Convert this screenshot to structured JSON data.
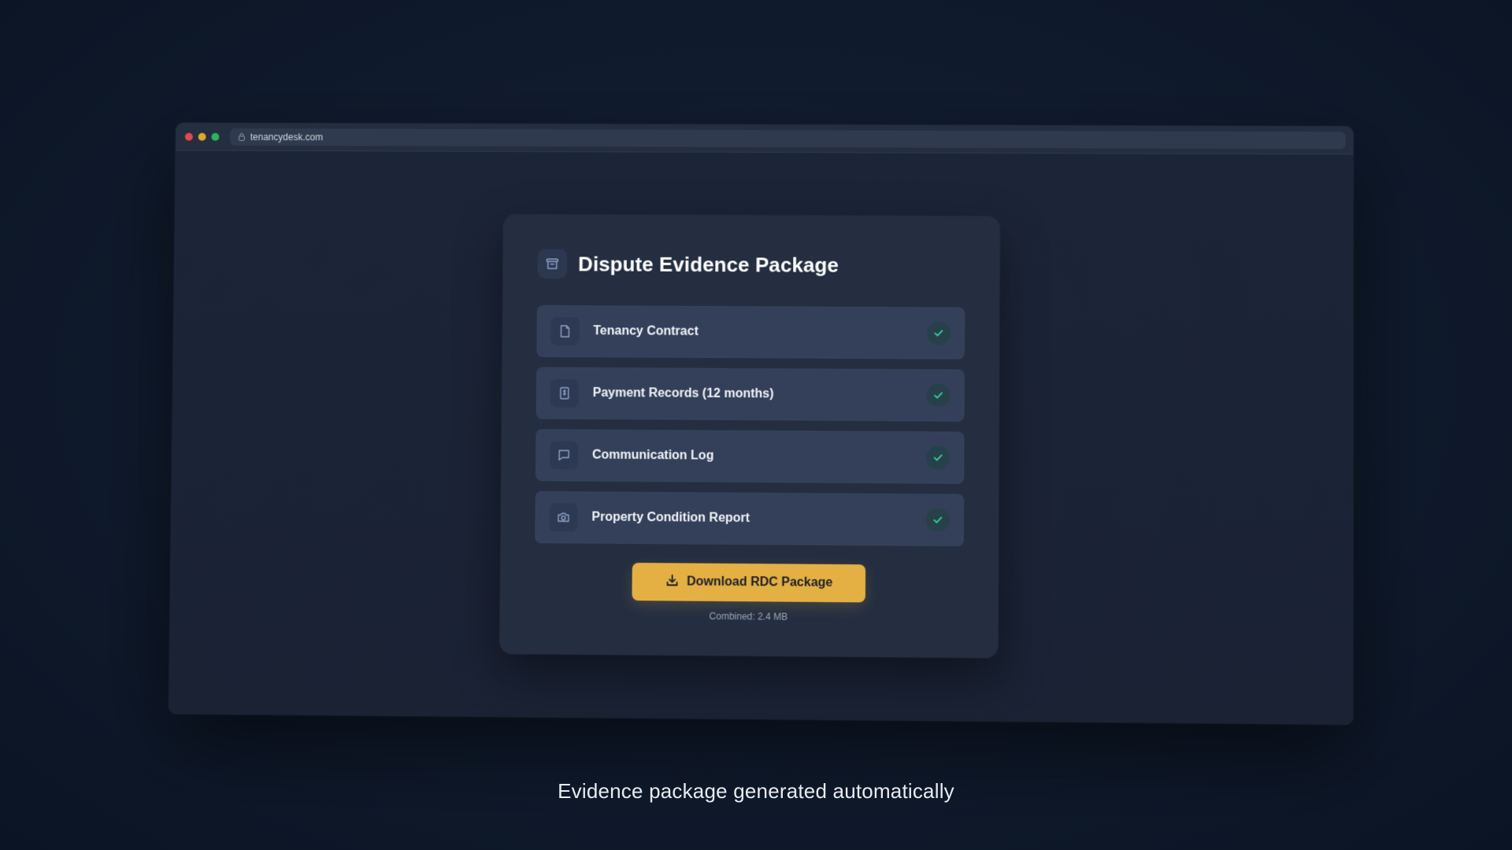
{
  "browser": {
    "url": "tenancydesk.com",
    "traffic_lights": {
      "red": "#e5484d",
      "yellow": "#e4a62b",
      "green": "#2fb35a"
    }
  },
  "card": {
    "title": "Dispute Evidence Package",
    "header_icon": "package-icon",
    "items": [
      {
        "label": "Tenancy Contract",
        "icon": "document-icon",
        "status": "complete"
      },
      {
        "label": "Payment Records (12 months)",
        "icon": "receipt-icon",
        "status": "complete"
      },
      {
        "label": "Communication Log",
        "icon": "chat-bubble-icon",
        "status": "complete"
      },
      {
        "label": "Property Condition Report",
        "icon": "camera-icon",
        "status": "complete"
      }
    ],
    "download_button": {
      "label": "Download RDC Package",
      "icon": "download-icon"
    },
    "file_size": "Combined: 2.4 MB"
  },
  "caption": "Evidence package generated automatically",
  "colors": {
    "accent": "#e4b043",
    "check": "#34d399",
    "card_bg": "#242e40",
    "item_bg": "#34405a",
    "icon_tint": "#8fa3c7"
  }
}
